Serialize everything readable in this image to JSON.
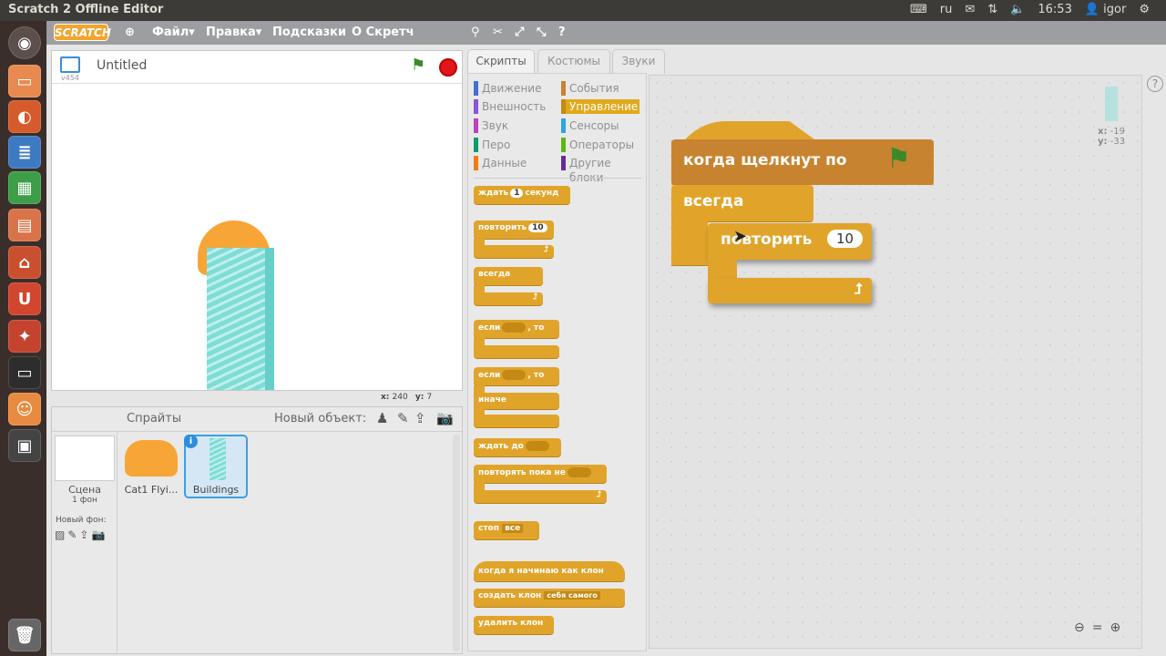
{
  "window_title": "Scratch 2 Offline Editor",
  "system": {
    "lang": "ru",
    "time": "16:53",
    "user": "igor"
  },
  "menu": {
    "logo": "SCRATCH",
    "file": "Файл",
    "edit": "Правка",
    "tips": "Подсказки",
    "about": "О Скретч"
  },
  "stage": {
    "project_title": "Untitled",
    "version": "v454",
    "x_label": "x:",
    "x_value": "240",
    "y_label": "y:",
    "y_value": "7"
  },
  "tabs": [
    {
      "label": "Скрипты"
    },
    {
      "label": "Костюмы"
    },
    {
      "label": "Звуки"
    }
  ],
  "categories": {
    "left": [
      {
        "label": "Движение",
        "color": "#4a6cd4"
      },
      {
        "label": "Внешность",
        "color": "#8a55d7"
      },
      {
        "label": "Звук",
        "color": "#bb42c3"
      },
      {
        "label": "Перо",
        "color": "#0e9a6c"
      },
      {
        "label": "Данные",
        "color": "#ee7d16"
      }
    ],
    "right": [
      {
        "label": "События",
        "color": "#c88330"
      },
      {
        "label": "Управление",
        "color": "#e1a91a"
      },
      {
        "label": "Сенсоры",
        "color": "#2ca5e2"
      },
      {
        "label": "Операторы",
        "color": "#5cb712"
      },
      {
        "label": "Другие блоки",
        "color": "#632d99"
      }
    ]
  },
  "palette": {
    "wait": "ждать",
    "wait_val": "1",
    "wait_unit": "секунд",
    "repeat": "повторить",
    "repeat_val": "10",
    "forever": "всегда",
    "if": "если",
    "then": ", то",
    "else": "иначе",
    "wait_until": "ждать до",
    "repeat_until": "повторять пока не",
    "stop": "стоп",
    "stop_opt": "все",
    "when_clone": "когда я начинаю как клон",
    "create_clone": "создать клон",
    "clone_opt": "себя самого",
    "delete_clone": "удалить клон"
  },
  "script": {
    "hat": "когда щелкнут по",
    "forever": "всегда",
    "repeat": "повторить",
    "repeat_val": "10"
  },
  "script_area": {
    "x_label": "x:",
    "x_value": "-19",
    "y_label": "y:",
    "y_value": "-33"
  },
  "sprites_panel": {
    "title": "Спрайты",
    "new_object": "Новый объект:",
    "scene": "Сцена",
    "backdrops": "1 фон",
    "new_backdrop": "Новый фон:",
    "sprites": [
      {
        "name": "Cat1 Flyi..."
      },
      {
        "name": "Buildings"
      }
    ]
  }
}
